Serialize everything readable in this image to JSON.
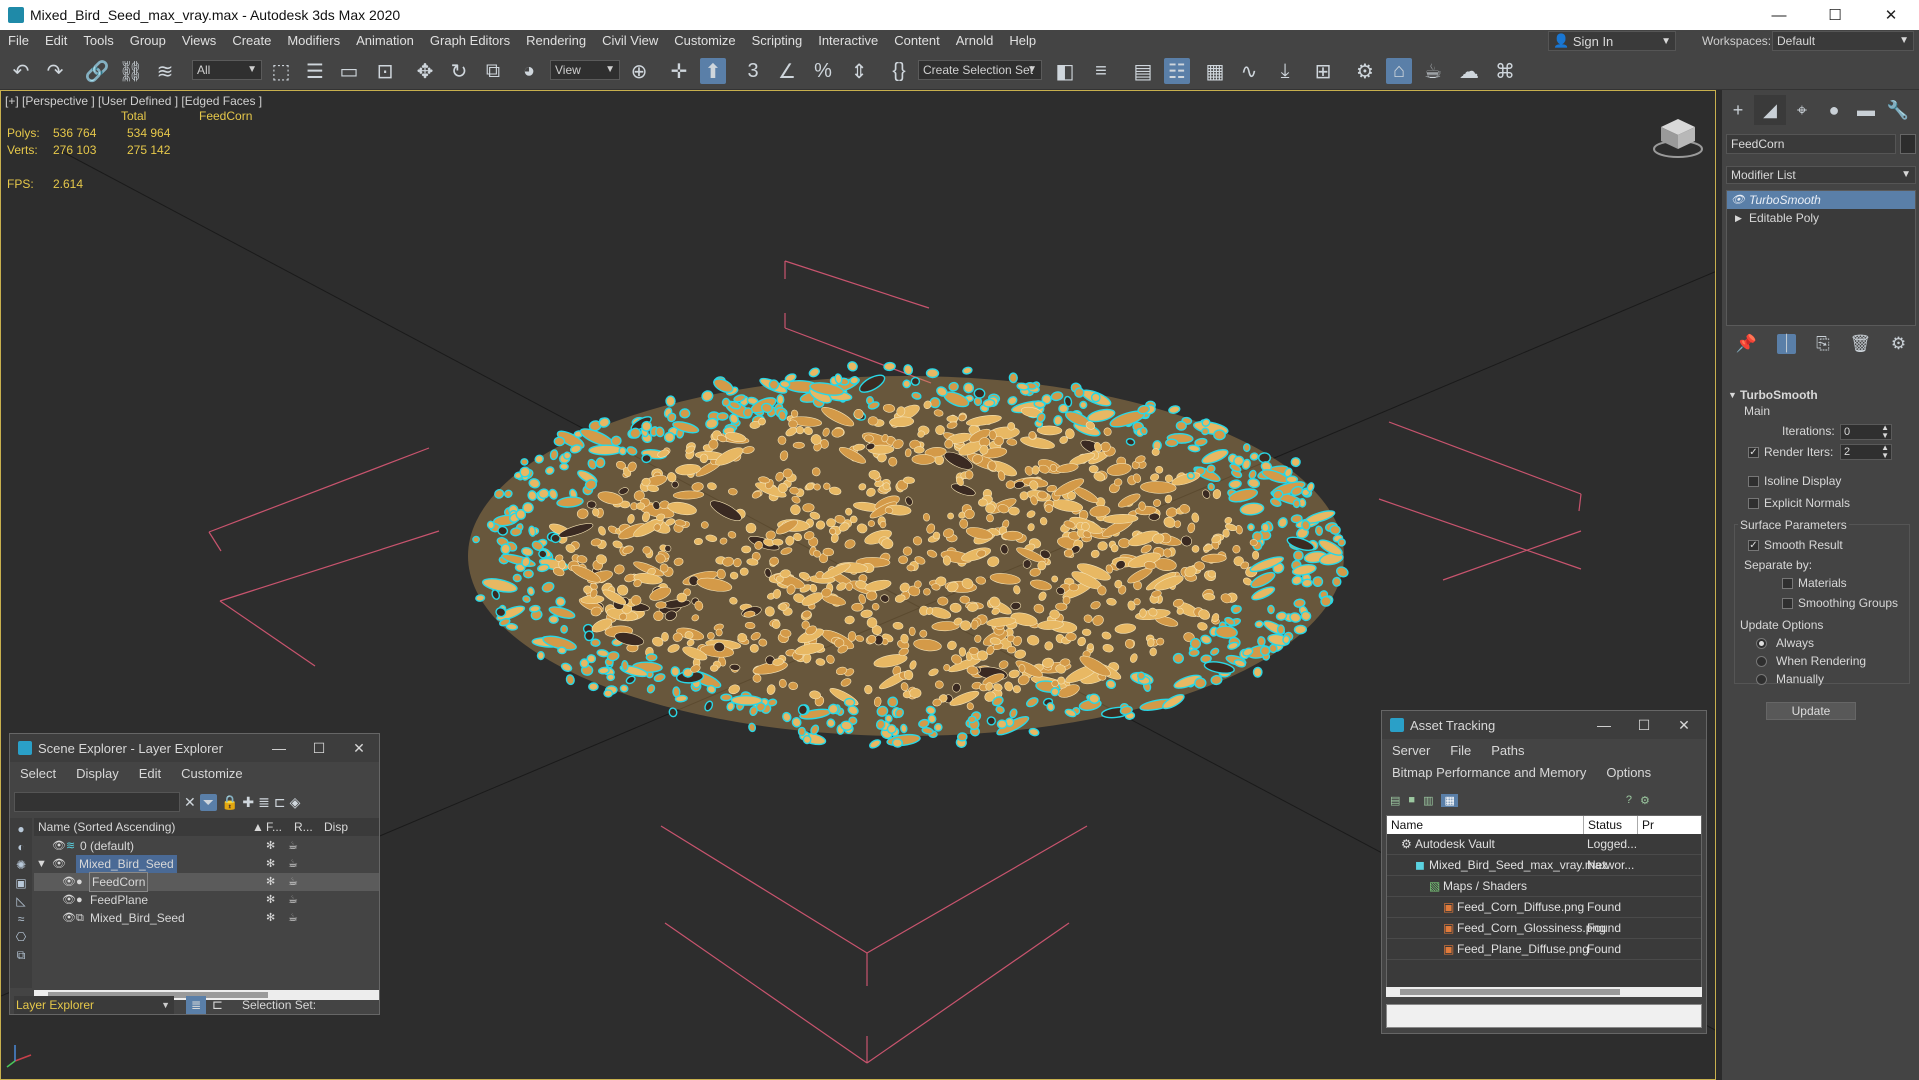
{
  "window": {
    "title": "Mixed_Bird_Seed_max_vray.max - Autodesk 3ds Max 2020",
    "minimize": "—",
    "maximize": "☐",
    "close": "✕"
  },
  "menubar": {
    "items": [
      "File",
      "Edit",
      "Tools",
      "Group",
      "Views",
      "Create",
      "Modifiers",
      "Animation",
      "Graph Editors",
      "Rendering",
      "Civil View",
      "Customize",
      "Scripting",
      "Interactive",
      "Content",
      "Arnold",
      "Help"
    ],
    "sign_in": "Sign In",
    "workspaces_label": "Workspaces:",
    "workspace_value": "Default"
  },
  "toolbar": {
    "selection_filter": "All",
    "ref_coord": "View",
    "selection_set_placeholder": "Create Selection Set"
  },
  "viewport": {
    "label": "[+] [Perspective ] [User Defined ] [Edged Faces ]",
    "stats": {
      "col_total": "Total",
      "col_object": "FeedCorn",
      "polys_label": "Polys:",
      "polys_total": "536 764",
      "polys_object": "534 964",
      "verts_label": "Verts:",
      "verts_total": "276 103",
      "verts_object": "275 142",
      "fps_label": "FPS:",
      "fps_value": "2.614"
    }
  },
  "command_panel": {
    "object_name": "FeedCorn",
    "modifier_list": "Modifier List",
    "stack": [
      {
        "name": "TurboSmooth",
        "selected": true
      },
      {
        "name": "Editable Poly",
        "selected": false
      }
    ],
    "turbosmooth": {
      "title": "TurboSmooth",
      "main_label": "Main",
      "iterations_label": "Iterations:",
      "iterations_value": "0",
      "render_iters_label": "Render Iters:",
      "render_iters_value": "2",
      "render_iters_checked": true,
      "isoline_display": "Isoline Display",
      "explicit_normals": "Explicit Normals",
      "surface_params_label": "Surface Parameters",
      "smooth_result": "Smooth Result",
      "separate_by": "Separate by:",
      "materials": "Materials",
      "smoothing_groups": "Smoothing Groups",
      "update_options_label": "Update Options",
      "always": "Always",
      "when_rendering": "When Rendering",
      "manually": "Manually",
      "update_button": "Update"
    }
  },
  "scene_explorer": {
    "title": "Scene Explorer - Layer Explorer",
    "menu": [
      "Select",
      "Display",
      "Edit",
      "Customize"
    ],
    "columns": {
      "name": "Name (Sorted Ascending)",
      "frozen": "F...",
      "render": "R...",
      "display": "Disp"
    },
    "rows": [
      {
        "name": "0 (default)",
        "indent": 1
      },
      {
        "name": "Mixed_Bird_Seed",
        "indent": 0
      },
      {
        "name": "FeedCorn",
        "indent": 2
      },
      {
        "name": "FeedPlane",
        "indent": 2
      },
      {
        "name": "Mixed_Bird_Seed",
        "indent": 2
      }
    ],
    "footer_select": "Layer Explorer",
    "selection_set_label": "Selection Set:"
  },
  "asset_tracking": {
    "title": "Asset Tracking",
    "menu": [
      "Server",
      "File",
      "Paths"
    ],
    "menu2": [
      "Bitmap Performance and Memory",
      "Options"
    ],
    "columns": {
      "name": "Name",
      "status": "Status",
      "extra": "Pr"
    },
    "rows": [
      {
        "name": "Autodesk Vault",
        "status": "Logged..."
      },
      {
        "name": "Mixed_Bird_Seed_max_vray.max",
        "status": "Networ..."
      },
      {
        "name": "Maps / Shaders",
        "status": ""
      },
      {
        "name": "Feed_Corn_Diffuse.png",
        "status": "Found"
      },
      {
        "name": "Feed_Corn_Glossiness.png",
        "status": "Found"
      },
      {
        "name": "Feed_Plane_Diffuse.png",
        "status": "Found"
      }
    ]
  },
  "colors": {
    "accent_blue": "#5a7fa8",
    "stats_yellow": "#e6c84a",
    "selection_cyan": "#29d7e6",
    "seed_tan": "#e8b863",
    "grid_pink": "#c8546e"
  }
}
